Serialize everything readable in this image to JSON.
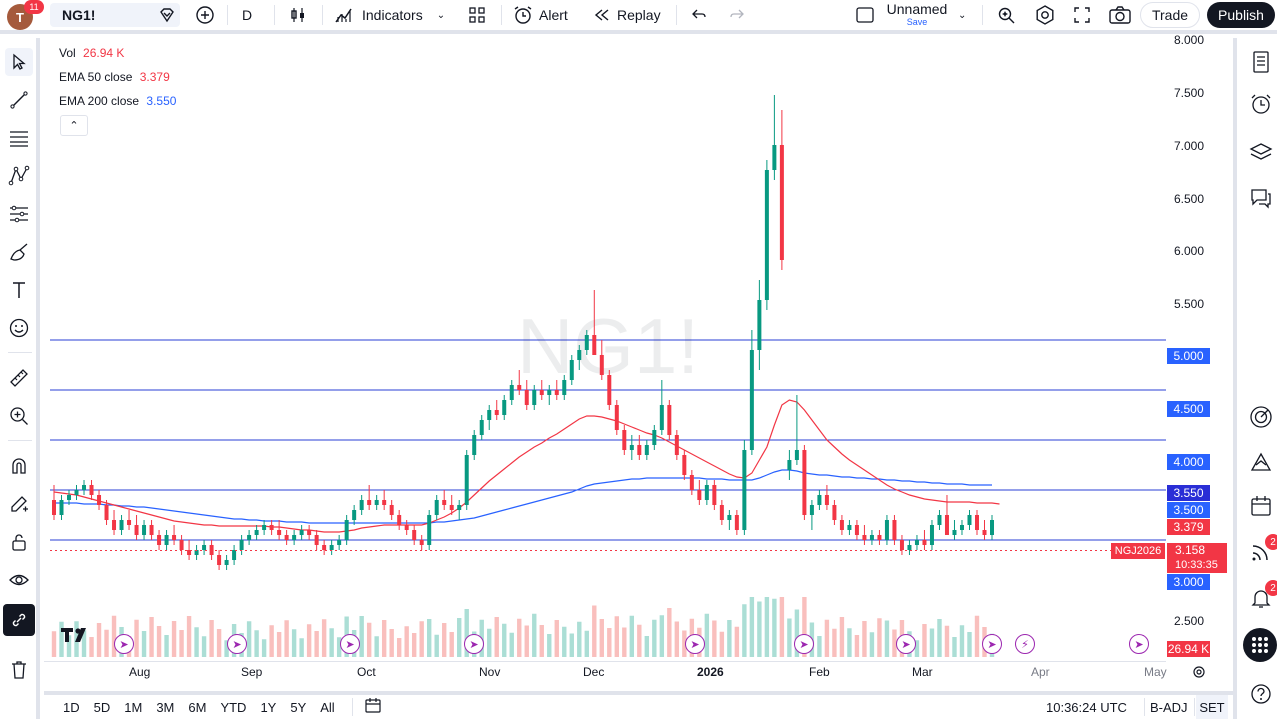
{
  "header": {
    "avatar_letter": "T",
    "notif_count": "11",
    "symbol": "NG1!",
    "interval": "D",
    "indicators_label": "Indicators",
    "alert_label": "Alert",
    "replay_label": "Replay",
    "layout_name": "Unnamed",
    "layout_save": "Save",
    "trade_label": "Trade",
    "publish_label": "Publish"
  },
  "legend": {
    "vol_label": "Vol",
    "vol_value": "26.94 K",
    "ema50_label": "EMA 50 close",
    "ema50_value": "3.379",
    "ema200_label": "EMA 200 close",
    "ema200_value": "3.550"
  },
  "watermark": "NG1!",
  "price_axis": [
    "8.000",
    "7.500",
    "7.000",
    "6.500",
    "6.000",
    "5.500",
    "5.000",
    "4.500",
    "4.000",
    "3.500",
    "3.000",
    "2.500"
  ],
  "price_tags": {
    "ema200": "3.550",
    "level_3500": "3.500",
    "ema50": "3.379",
    "contract": "NGJ2026",
    "last": "3.158",
    "countdown": "10:33:35",
    "level_3000": "3.000",
    "level_5000": "5.000",
    "level_4500": "4.500",
    "level_4000": "4.000",
    "volume": "26.94 K"
  },
  "time_axis": [
    "Aug",
    "Sep",
    "Oct",
    "Nov",
    "Dec",
    "2026",
    "Feb",
    "Mar",
    "Apr",
    "May"
  ],
  "bottom": {
    "ranges": [
      "1D",
      "5D",
      "1M",
      "3M",
      "6M",
      "YTD",
      "1Y",
      "5Y",
      "All"
    ],
    "clock": "10:36:24 UTC",
    "badj": "B-ADJ",
    "session": "SET"
  },
  "right_badges": {
    "ideas": "2",
    "alerts": "2"
  },
  "colors": {
    "up": "#089981",
    "down": "#f23645",
    "ema50": "#f23645",
    "ema200": "#2962ff",
    "hline": "#2a3fd6",
    "tag_blue": "#2962ff"
  },
  "chart_data": {
    "type": "candlestick",
    "ylim": [
      2.35,
      8.0
    ],
    "horizontal_levels": [
      5.0,
      4.5,
      4.0,
      3.5,
      3.0
    ],
    "candles": [
      [
        3.4,
        3.55,
        3.2,
        3.25
      ],
      [
        3.25,
        3.45,
        3.2,
        3.4
      ],
      [
        3.4,
        3.5,
        3.35,
        3.45
      ],
      [
        3.45,
        3.55,
        3.4,
        3.5
      ],
      [
        3.5,
        3.6,
        3.45,
        3.55
      ],
      [
        3.55,
        3.6,
        3.4,
        3.45
      ],
      [
        3.45,
        3.5,
        3.3,
        3.35
      ],
      [
        3.35,
        3.4,
        3.15,
        3.2
      ],
      [
        3.2,
        3.3,
        3.05,
        3.1
      ],
      [
        3.1,
        3.25,
        3.05,
        3.2
      ],
      [
        3.2,
        3.3,
        3.1,
        3.15
      ],
      [
        3.15,
        3.25,
        3.0,
        3.05
      ],
      [
        3.05,
        3.2,
        3.0,
        3.15
      ],
      [
        3.15,
        3.2,
        3.0,
        3.05
      ],
      [
        3.05,
        3.1,
        2.9,
        2.95
      ],
      [
        2.95,
        3.1,
        2.9,
        3.05
      ],
      [
        3.05,
        3.15,
        2.95,
        3.0
      ],
      [
        3.0,
        3.05,
        2.85,
        2.9
      ],
      [
        2.9,
        3.0,
        2.8,
        2.85
      ],
      [
        2.85,
        2.95,
        2.8,
        2.9
      ],
      [
        2.9,
        3.0,
        2.85,
        2.95
      ],
      [
        2.95,
        3.0,
        2.8,
        2.85
      ],
      [
        2.85,
        2.9,
        2.7,
        2.75
      ],
      [
        2.75,
        2.85,
        2.7,
        2.8
      ],
      [
        2.8,
        2.95,
        2.75,
        2.9
      ],
      [
        2.9,
        3.05,
        2.85,
        3.0
      ],
      [
        3.0,
        3.1,
        2.95,
        3.05
      ],
      [
        3.05,
        3.15,
        3.0,
        3.1
      ],
      [
        3.1,
        3.2,
        3.05,
        3.15
      ],
      [
        3.15,
        3.2,
        3.05,
        3.1
      ],
      [
        3.1,
        3.2,
        3.0,
        3.05
      ],
      [
        3.05,
        3.1,
        2.95,
        3.0
      ],
      [
        3.0,
        3.1,
        2.95,
        3.05
      ],
      [
        3.05,
        3.15,
        3.0,
        3.1
      ],
      [
        3.1,
        3.15,
        3.0,
        3.05
      ],
      [
        3.05,
        3.1,
        2.9,
        2.95
      ],
      [
        2.95,
        3.0,
        2.85,
        2.9
      ],
      [
        2.9,
        3.0,
        2.85,
        2.95
      ],
      [
        2.95,
        3.05,
        2.9,
        3.0
      ],
      [
        3.0,
        3.25,
        2.95,
        3.2
      ],
      [
        3.2,
        3.35,
        3.15,
        3.3
      ],
      [
        3.3,
        3.45,
        3.25,
        3.4
      ],
      [
        3.4,
        3.55,
        3.3,
        3.35
      ],
      [
        3.35,
        3.45,
        3.3,
        3.4
      ],
      [
        3.4,
        3.5,
        3.3,
        3.35
      ],
      [
        3.35,
        3.4,
        3.2,
        3.25
      ],
      [
        3.25,
        3.3,
        3.1,
        3.15
      ],
      [
        3.15,
        3.2,
        3.05,
        3.1
      ],
      [
        3.1,
        3.15,
        2.95,
        3.0
      ],
      [
        3.0,
        3.05,
        2.9,
        2.95
      ],
      [
        2.95,
        3.3,
        2.9,
        3.25
      ],
      [
        3.25,
        3.45,
        3.2,
        3.4
      ],
      [
        3.4,
        3.5,
        3.3,
        3.35
      ],
      [
        3.35,
        3.45,
        3.25,
        3.3
      ],
      [
        3.3,
        3.4,
        3.2,
        3.35
      ],
      [
        3.35,
        3.9,
        3.3,
        3.85
      ],
      [
        3.85,
        4.1,
        3.8,
        4.05
      ],
      [
        4.05,
        4.25,
        4.0,
        4.2
      ],
      [
        4.2,
        4.35,
        4.1,
        4.3
      ],
      [
        4.3,
        4.4,
        4.2,
        4.25
      ],
      [
        4.25,
        4.45,
        4.2,
        4.4
      ],
      [
        4.4,
        4.6,
        4.35,
        4.55
      ],
      [
        4.55,
        4.7,
        4.45,
        4.5
      ],
      [
        4.5,
        4.6,
        4.3,
        4.35
      ],
      [
        4.35,
        4.55,
        4.3,
        4.5
      ],
      [
        4.5,
        4.6,
        4.4,
        4.45
      ],
      [
        4.45,
        4.55,
        4.35,
        4.5
      ],
      [
        4.5,
        4.6,
        4.4,
        4.45
      ],
      [
        4.45,
        4.65,
        4.4,
        4.6
      ],
      [
        4.6,
        4.85,
        4.55,
        4.8
      ],
      [
        4.8,
        4.95,
        4.7,
        4.9
      ],
      [
        4.9,
        5.1,
        4.85,
        5.05
      ],
      [
        5.05,
        5.5,
        5.0,
        4.85
      ],
      [
        4.85,
        5.0,
        4.6,
        4.65
      ],
      [
        4.65,
        4.7,
        4.3,
        4.35
      ],
      [
        4.35,
        4.4,
        4.05,
        4.1
      ],
      [
        4.1,
        4.15,
        3.85,
        3.9
      ],
      [
        3.9,
        4.05,
        3.8,
        3.95
      ],
      [
        3.95,
        4.05,
        3.8,
        3.85
      ],
      [
        3.85,
        4.0,
        3.8,
        3.95
      ],
      [
        3.95,
        4.15,
        3.9,
        4.1
      ],
      [
        4.1,
        4.6,
        4.05,
        4.35
      ],
      [
        4.35,
        4.4,
        4.0,
        4.05
      ],
      [
        4.05,
        4.1,
        3.8,
        3.85
      ],
      [
        3.85,
        3.9,
        3.6,
        3.65
      ],
      [
        3.65,
        3.7,
        3.45,
        3.5
      ],
      [
        3.5,
        3.6,
        3.35,
        3.4
      ],
      [
        3.4,
        3.6,
        3.35,
        3.55
      ],
      [
        3.55,
        3.6,
        3.3,
        3.35
      ],
      [
        3.35,
        3.4,
        3.15,
        3.2
      ],
      [
        3.2,
        3.3,
        3.1,
        3.25
      ],
      [
        3.25,
        3.3,
        3.05,
        3.1
      ],
      [
        3.1,
        4.0,
        3.05,
        3.9
      ],
      [
        3.9,
        5.1,
        3.85,
        4.9
      ],
      [
        4.9,
        5.6,
        4.7,
        5.4
      ],
      [
        5.4,
        6.8,
        5.3,
        6.7
      ],
      [
        6.7,
        7.45,
        6.6,
        6.95
      ],
      [
        6.95,
        7.3,
        5.7,
        5.8
      ],
      [
        3.7,
        3.9,
        3.6,
        3.8
      ],
      [
        3.8,
        4.45,
        3.75,
        3.9
      ],
      [
        3.9,
        3.95,
        3.2,
        3.25
      ],
      [
        3.25,
        3.4,
        3.1,
        3.35
      ],
      [
        3.35,
        3.5,
        3.3,
        3.45
      ],
      [
        3.45,
        3.55,
        3.3,
        3.35
      ],
      [
        3.35,
        3.4,
        3.15,
        3.2
      ],
      [
        3.2,
        3.25,
        3.05,
        3.1
      ],
      [
        3.1,
        3.2,
        3.05,
        3.15
      ],
      [
        3.15,
        3.2,
        3.0,
        3.05
      ],
      [
        3.05,
        3.15,
        2.95,
        3.0
      ],
      [
        3.0,
        3.1,
        2.95,
        3.05
      ],
      [
        3.05,
        3.1,
        2.95,
        3.0
      ],
      [
        3.0,
        3.25,
        2.95,
        3.2
      ],
      [
        3.2,
        3.25,
        2.95,
        3.0
      ],
      [
        3.0,
        3.05,
        2.85,
        2.9
      ],
      [
        2.9,
        3.0,
        2.85,
        2.95
      ],
      [
        2.95,
        3.05,
        2.9,
        3.0
      ],
      [
        3.0,
        3.1,
        2.9,
        2.95
      ],
      [
        2.95,
        3.2,
        2.9,
        3.15
      ],
      [
        3.15,
        3.3,
        3.1,
        3.25
      ],
      [
        3.25,
        3.45,
        3.2,
        3.05
      ],
      [
        3.05,
        3.2,
        3.0,
        3.1
      ],
      [
        3.1,
        3.2,
        3.05,
        3.15
      ],
      [
        3.15,
        3.3,
        3.1,
        3.25
      ],
      [
        3.25,
        3.3,
        3.05,
        3.1
      ],
      [
        3.1,
        3.2,
        3.0,
        3.05
      ],
      [
        3.05,
        3.25,
        3.0,
        3.2
      ]
    ],
    "ema50": [
      3.48,
      3.47,
      3.46,
      3.45,
      3.43,
      3.41,
      3.39,
      3.37,
      3.35,
      3.33,
      3.31,
      3.29,
      3.27,
      3.25,
      3.23,
      3.21,
      3.19,
      3.18,
      3.17,
      3.16,
      3.15,
      3.15,
      3.14,
      3.14,
      3.14,
      3.14,
      3.14,
      3.14,
      3.14,
      3.13,
      3.13,
      3.12,
      3.11,
      3.1,
      3.1,
      3.09,
      3.08,
      3.08,
      3.08,
      3.09,
      3.1,
      3.12,
      3.13,
      3.14,
      3.15,
      3.15,
      3.15,
      3.15,
      3.15,
      3.15,
      3.17,
      3.2,
      3.23,
      3.27,
      3.32,
      3.38,
      3.45,
      3.52,
      3.59,
      3.65,
      3.71,
      3.77,
      3.83,
      3.88,
      3.93,
      3.97,
      4.02,
      4.06,
      4.11,
      4.16,
      4.21,
      4.24,
      4.24,
      4.23,
      4.21,
      4.19,
      4.16,
      4.13,
      4.1,
      4.07,
      4.05,
      4.02,
      3.98,
      3.94,
      3.9,
      3.86,
      3.82,
      3.78,
      3.74,
      3.7,
      3.66,
      3.63,
      3.62,
      3.67,
      3.8,
      3.93,
      4.15,
      4.35,
      4.4,
      4.38,
      4.3,
      4.2,
      4.1,
      4.0,
      3.93,
      3.86,
      3.8,
      3.75,
      3.7,
      3.65,
      3.6,
      3.55,
      3.51,
      3.48,
      3.45,
      3.43,
      3.41,
      3.4,
      3.39,
      3.38,
      3.38,
      3.38,
      3.38,
      3.37,
      3.37,
      3.37,
      3.36
    ],
    "ema200": [
      3.37,
      3.37,
      3.37,
      3.37,
      3.36,
      3.36,
      3.36,
      3.35,
      3.35,
      3.34,
      3.34,
      3.33,
      3.33,
      3.32,
      3.31,
      3.3,
      3.29,
      3.28,
      3.27,
      3.26,
      3.25,
      3.24,
      3.23,
      3.22,
      3.21,
      3.21,
      3.2,
      3.2,
      3.19,
      3.19,
      3.19,
      3.18,
      3.18,
      3.18,
      3.17,
      3.17,
      3.17,
      3.17,
      3.17,
      3.17,
      3.17,
      3.17,
      3.17,
      3.17,
      3.17,
      3.17,
      3.17,
      3.17,
      3.17,
      3.17,
      3.17,
      3.18,
      3.18,
      3.19,
      3.2,
      3.21,
      3.22,
      3.24,
      3.26,
      3.28,
      3.3,
      3.32,
      3.34,
      3.36,
      3.38,
      3.4,
      3.42,
      3.44,
      3.46,
      3.48,
      3.51,
      3.54,
      3.56,
      3.57,
      3.58,
      3.59,
      3.6,
      3.61,
      3.61,
      3.62,
      3.62,
      3.62,
      3.62,
      3.62,
      3.62,
      3.62,
      3.62,
      3.61,
      3.61,
      3.61,
      3.6,
      3.6,
      3.6,
      3.6,
      3.62,
      3.65,
      3.68,
      3.7,
      3.7,
      3.69,
      3.67,
      3.66,
      3.65,
      3.65,
      3.64,
      3.63,
      3.63,
      3.62,
      3.62,
      3.61,
      3.61,
      3.6,
      3.6,
      3.59,
      3.59,
      3.58,
      3.58,
      3.57,
      3.57,
      3.56,
      3.56,
      3.56,
      3.55,
      3.55,
      3.55,
      3.55
    ]
  }
}
